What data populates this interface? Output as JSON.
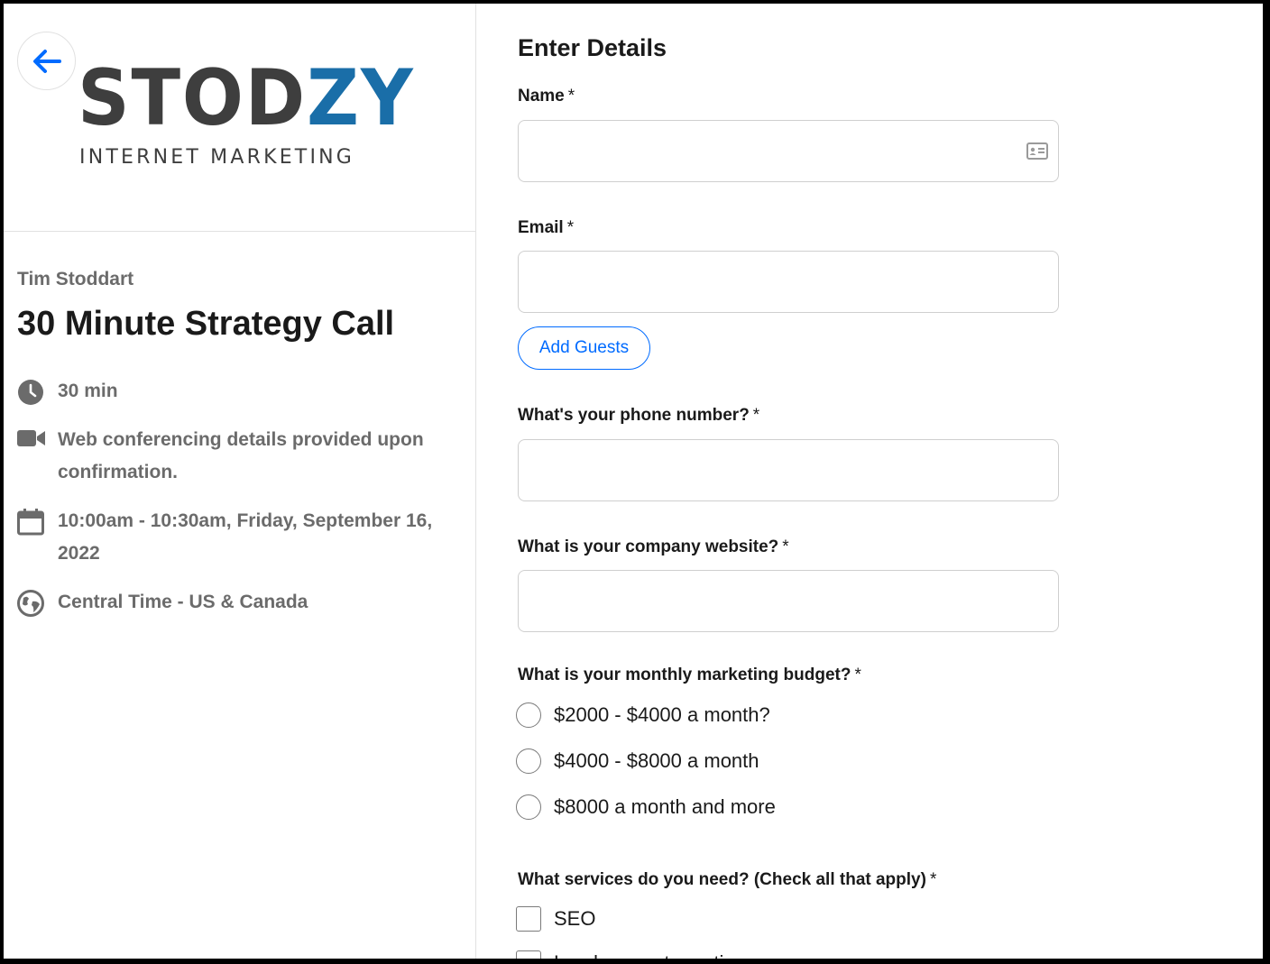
{
  "sidebar": {
    "back_label": "Back",
    "logo": {
      "word_dark": "STOD",
      "word_blue": "ZY",
      "tagline": "INTERNET MARKETING"
    },
    "owner": "Tim Stoddart",
    "event_title": "30 Minute Strategy Call",
    "details": {
      "duration": "30 min",
      "conferencing": "Web conferencing details provided upon confirmation.",
      "datetime": "10:00am - 10:30am, Friday, September 16, 2022",
      "timezone": "Central Time - US & Canada"
    }
  },
  "form": {
    "title": "Enter Details",
    "name_label": "Name",
    "email_label": "Email",
    "add_guests_label": "Add Guests",
    "phone_label": "What's your phone number?",
    "website_label": "What is your company website?",
    "budget_label": "What is your monthly marketing budget?",
    "budget_options": [
      "$2000 - $4000 a month?",
      "$4000 - $8000 a month",
      "$8000 a month and more"
    ],
    "services_label": "What services do you need? (Check all that apply)",
    "services_options": [
      "SEO",
      "Lead magnet creation"
    ],
    "required_mark": "*"
  },
  "colors": {
    "accent": "#006bff",
    "logo_blue": "#1a6ea8",
    "logo_dark": "#3e3e3e",
    "muted_text": "#6b6b6b"
  }
}
